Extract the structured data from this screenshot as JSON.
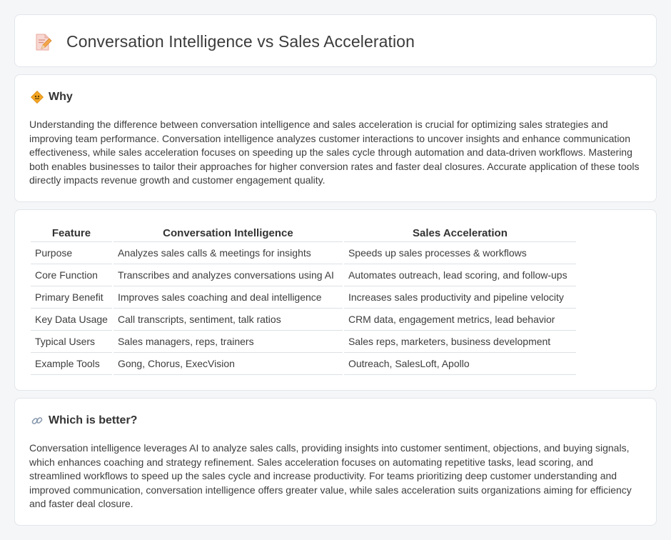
{
  "page": {
    "title": "Conversation Intelligence vs Sales Acceleration",
    "title_icon": "document-pencil-icon"
  },
  "why": {
    "icon": "road-sign-icon",
    "heading": "Why",
    "text": "Understanding the difference between conversation intelligence and sales acceleration is crucial for optimizing sales strategies and improving team performance. Conversation intelligence analyzes customer interactions to uncover insights and enhance communication effectiveness, while sales acceleration focuses on speeding up the sales cycle through automation and data-driven workflows. Mastering both enables businesses to tailor their approaches for higher conversion rates and faster deal closures. Accurate application of these tools directly impacts revenue growth and customer engagement quality."
  },
  "table": {
    "headers": [
      "Feature",
      "Conversation Intelligence",
      "Sales Acceleration"
    ],
    "rows": [
      [
        "Purpose",
        "Analyzes sales calls & meetings for insights",
        "Speeds up sales processes & workflows"
      ],
      [
        "Core Function",
        "Transcribes and analyzes conversations using AI",
        "Automates outreach, lead scoring, and follow-ups"
      ],
      [
        "Primary Benefit",
        "Improves sales coaching and deal intelligence",
        "Increases sales productivity and pipeline velocity"
      ],
      [
        "Key Data Usage",
        "Call transcripts, sentiment, talk ratios",
        "CRM data, engagement metrics, lead behavior"
      ],
      [
        "Typical Users",
        "Sales managers, reps, trainers",
        "Sales reps, marketers, business development"
      ],
      [
        "Example Tools",
        "Gong, Chorus, ExecVision",
        "Outreach, SalesLoft, Apollo"
      ]
    ]
  },
  "better": {
    "icon": "link-icon",
    "heading": "Which is better?",
    "text": "Conversation intelligence leverages AI to analyze sales calls, providing insights into customer sentiment, objections, and buying signals, which enhances coaching and strategy refinement. Sales acceleration focuses on automating repetitive tasks, lead scoring, and streamlined workflows to speed up the sales cycle and increase productivity. For teams prioritizing deep customer understanding and improved communication, conversation intelligence offers greater value, while sales acceleration suits organizations aiming for efficiency and faster deal closure."
  }
}
